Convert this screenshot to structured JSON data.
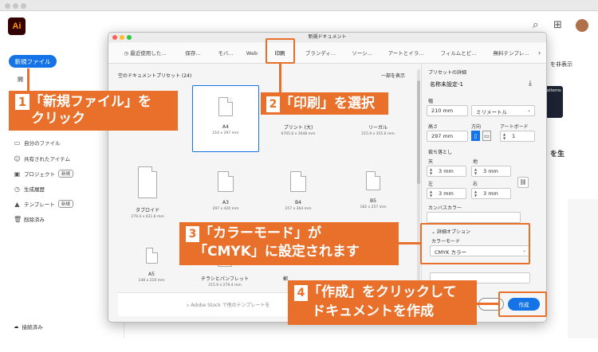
{
  "app": {
    "logo": "Ai"
  },
  "home": {
    "new_file": "新規ファイル",
    "open": "開",
    "sidebar": [
      {
        "label": "自分のファイル",
        "icon": "file-icon",
        "badge": ""
      },
      {
        "label": "共有されたアイテム",
        "icon": "people-icon",
        "badge": ""
      },
      {
        "label": "プロジェクト",
        "icon": "folder-icon",
        "badge": "新規"
      },
      {
        "label": "生成履歴",
        "icon": "history-icon",
        "badge": ""
      },
      {
        "label": "テンプレート",
        "icon": "template-icon",
        "badge": "新規"
      },
      {
        "label": "削除済み",
        "icon": "trash-icon",
        "badge": ""
      }
    ],
    "connected": "接続済み",
    "right_hide": "を非表示",
    "right_patterns": "Patterns",
    "right_heading": "を生"
  },
  "dialog": {
    "title": "新規ドキュメント",
    "tabs": [
      "最近使用した...",
      "保存...",
      "モバ...",
      "Web",
      "印刷",
      "ブランディ...",
      "ソーシ...",
      "アートとイラ...",
      "フィルムとビ...",
      "無料テンプレ..."
    ],
    "active_tab": "印刷",
    "presets_title": "空のドキュメントプリセット (24)",
    "show_all": "一部を表示",
    "presets": [
      {
        "name": "A4",
        "size": "210 x 297 mm"
      },
      {
        "name": "プリント (大)",
        "size": "6705.6 x 3048 mm"
      },
      {
        "name": "リーガル",
        "size": "215.9 x 355.6 mm"
      },
      {
        "name": "タブロイド",
        "size": "279.4 x 431.8 mm"
      },
      {
        "name": "A3",
        "size": "297 x 420 mm"
      },
      {
        "name": "B4",
        "size": "257 x 364 mm"
      },
      {
        "name": "B5",
        "size": "182 x 257 mm"
      },
      {
        "name": "A5",
        "size": "148 x 210 mm"
      },
      {
        "name": "チラシとパンフレット",
        "size": "215.9 x 279.4 mm"
      },
      {
        "name": "郵",
        "size": ""
      }
    ],
    "stock_search_placeholder": "Adobe Stock で他のテンプレートを",
    "details": {
      "heading": "プリセットの詳細",
      "name": "名称未設定-1",
      "width_label": "幅",
      "width_value": "210 mm",
      "unit": "ミリメートル",
      "height_label": "高さ",
      "height_value": "297 mm",
      "orientation_label": "方向",
      "artboard_label": "アートボード",
      "artboard_value": "1",
      "bleed_label": "裁ち落とし",
      "top_label": "天",
      "top_value": "3 mm",
      "bottom_label": "地",
      "bottom_value": "3 mm",
      "left_label": "左",
      "left_value": "3 mm",
      "right_label": "右",
      "right_value": "3 mm",
      "canvas_color_label": "カンバスカラー",
      "advanced_label": "詳細オプション",
      "color_mode_label": "カラーモード",
      "color_mode_value": "CMYK カラー"
    },
    "create_label": "作成"
  },
  "callouts": [
    {
      "num": "1",
      "lines": [
        "「新規ファイル」を",
        "クリック"
      ]
    },
    {
      "num": "2",
      "lines": [
        "「印刷」を選択"
      ]
    },
    {
      "num": "3",
      "lines": [
        "「カラーモード」が",
        "「CMYK」に設定されます"
      ]
    },
    {
      "num": "4",
      "lines": [
        "「作成」をクリックして",
        "ドキュメントを作成"
      ]
    }
  ],
  "colors": {
    "accent": "#1473e6",
    "callout": "#e8702a"
  }
}
